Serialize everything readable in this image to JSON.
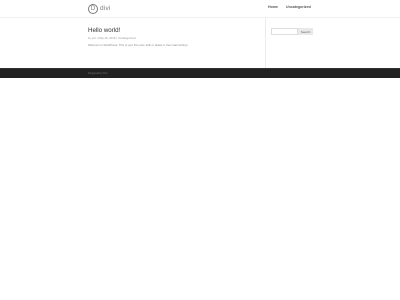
{
  "site": {
    "logo_mark": "D",
    "logo_text": "divi"
  },
  "nav": {
    "items": [
      {
        "label": "Home"
      },
      {
        "label": "Uncategorized"
      }
    ]
  },
  "post": {
    "title": "Hello world!",
    "meta": "by pvn | May 26, 2016 | Uncategorized",
    "excerpt": "Welcome to WordPress. This is your first post. Edit or delete it, then start writing!"
  },
  "sidebar": {
    "search_placeholder": "",
    "search_button": "Search"
  },
  "footer": {
    "text": "Designed by Divi"
  }
}
